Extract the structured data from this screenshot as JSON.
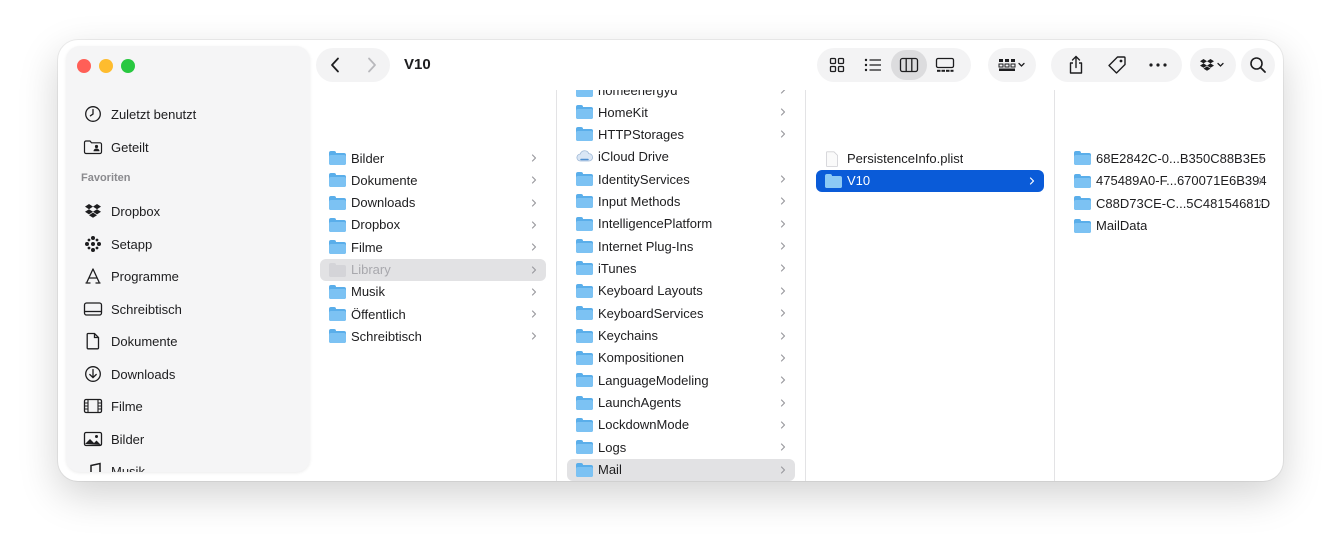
{
  "window": {
    "title": "V10"
  },
  "sidebar": {
    "top_items": [
      {
        "label": "Zuletzt benutzt",
        "icon": "clock-icon"
      },
      {
        "label": "Geteilt",
        "icon": "shared-folder-icon"
      }
    ],
    "section_label": "Favoriten",
    "favorites": [
      {
        "label": "Dropbox",
        "icon": "dropbox-icon"
      },
      {
        "label": "Setapp",
        "icon": "setapp-icon"
      },
      {
        "label": "Programme",
        "icon": "applications-icon"
      },
      {
        "label": "Schreibtisch",
        "icon": "desktop-icon"
      },
      {
        "label": "Dokumente",
        "icon": "document-icon"
      },
      {
        "label": "Downloads",
        "icon": "download-icon"
      },
      {
        "label": "Filme",
        "icon": "film-icon"
      },
      {
        "label": "Bilder",
        "icon": "photo-icon"
      },
      {
        "label": "Musik",
        "icon": "music-icon"
      }
    ]
  },
  "toolbar": {
    "back_icon": "chevron-left-icon",
    "forward_icon": "chevron-right-icon",
    "view_modes": [
      "icon-view-icon",
      "list-view-icon",
      "column-view-icon",
      "gallery-view-icon"
    ],
    "active_view": "column-view-icon",
    "group_icon": "group-by-icon",
    "share_icon": "share-icon",
    "tag_icon": "tag-icon",
    "more_icon": "more-icon",
    "dropbox_icon": "dropbox-icon",
    "search_icon": "search-icon"
  },
  "columns": {
    "col1": [
      {
        "label": "Bilder",
        "chevron": true
      },
      {
        "label": "Dokumente",
        "chevron": true
      },
      {
        "label": "Downloads",
        "chevron": true
      },
      {
        "label": "Dropbox",
        "chevron": true
      },
      {
        "label": "Filme",
        "chevron": true
      },
      {
        "label": "Library",
        "chevron": true,
        "state": "selected-inactive"
      },
      {
        "label": "Musik",
        "chevron": true
      },
      {
        "label": "Öffentlich",
        "chevron": true
      },
      {
        "label": "Schreibtisch",
        "chevron": true
      }
    ],
    "col2_partial": "homeenergyd",
    "col2": [
      {
        "label": "HomeKit",
        "chevron": true
      },
      {
        "label": "HTTPStorages",
        "chevron": true
      },
      {
        "label": "iCloud Drive",
        "chevron": false,
        "icon": "icloud-icon"
      },
      {
        "label": "IdentityServices",
        "chevron": true
      },
      {
        "label": "Input Methods",
        "chevron": true
      },
      {
        "label": "IntelligencePlatform",
        "chevron": true
      },
      {
        "label": "Internet Plug-Ins",
        "chevron": true
      },
      {
        "label": "iTunes",
        "chevron": true
      },
      {
        "label": "Keyboard Layouts",
        "chevron": true
      },
      {
        "label": "KeyboardServices",
        "chevron": true
      },
      {
        "label": "Keychains",
        "chevron": true
      },
      {
        "label": "Kompositionen",
        "chevron": true
      },
      {
        "label": "LanguageModeling",
        "chevron": true
      },
      {
        "label": "LaunchAgents",
        "chevron": true
      },
      {
        "label": "LockdownMode",
        "chevron": true
      },
      {
        "label": "Logs",
        "chevron": true
      },
      {
        "label": "Mail",
        "chevron": true,
        "state": "selected-inactive"
      }
    ],
    "col3": [
      {
        "label": "PersistenceInfo.plist",
        "chevron": false,
        "icon": "plist-file-icon"
      },
      {
        "label": "V10",
        "chevron": true,
        "state": "selected-active"
      }
    ],
    "col4": [
      {
        "label": "68E2842C-0...B350C88B3E5",
        "chevron": true
      },
      {
        "label": "475489A0-F...670071E6B394",
        "chevron": true
      },
      {
        "label": "C88D73CE-C...5C48154681D",
        "chevron": true
      },
      {
        "label": "MailData",
        "chevron": false
      }
    ]
  },
  "colors": {
    "accent": "#0a5bd8",
    "folder": "#5aaeea",
    "sidebar_bg": "#f5f5f6"
  }
}
